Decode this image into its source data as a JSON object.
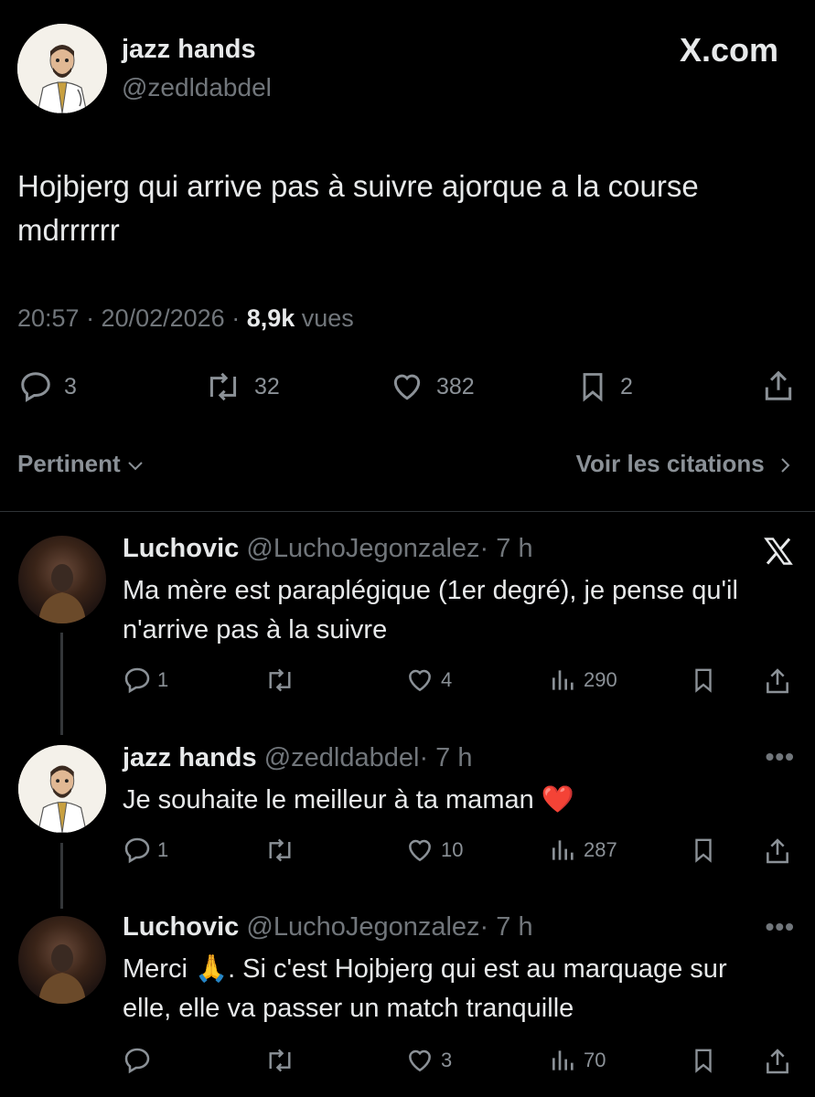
{
  "main": {
    "author_name": "jazz hands",
    "author_handle": "@zedldabdel",
    "brand": "X.com",
    "text": "Hojbjerg qui arrive pas à suivre ajorque a la course mdrrrrrr",
    "time": "20:57 · 20/02/2026 · ",
    "views_count": "8,9k",
    "views_label": " vues",
    "replies": "3",
    "reposts": "32",
    "likes": "382",
    "bookmarks": "2"
  },
  "sort": {
    "label": "Pertinent",
    "quotes_label": "Voir les citations"
  },
  "replies": [
    {
      "name": "Luchovic",
      "handle": "@LuchoJegonzalez",
      "time": "· 7 h",
      "text": "Ma mère est paraplégique (1er degré), je pense qu'il n'arrive pas à la suivre",
      "replies": "1",
      "reposts": "",
      "likes": "4",
      "views": "290"
    },
    {
      "name": "jazz hands",
      "handle": "@zedldabdel",
      "time": "· 7 h",
      "text": "Je souhaite le meilleur à ta maman",
      "emoji": "❤️",
      "replies": "1",
      "reposts": "",
      "likes": "10",
      "views": "287"
    },
    {
      "name": "Luchovic",
      "handle": "@LuchoJegonzalez",
      "time": "· 7 h",
      "text_before": "Merci ",
      "emoji": "🙏",
      "text_after": ". Si c'est Hojbjerg qui est au marquage sur elle, elle va passer un match tranquille",
      "replies": "",
      "reposts": "",
      "likes": "3",
      "views": "70"
    }
  ]
}
